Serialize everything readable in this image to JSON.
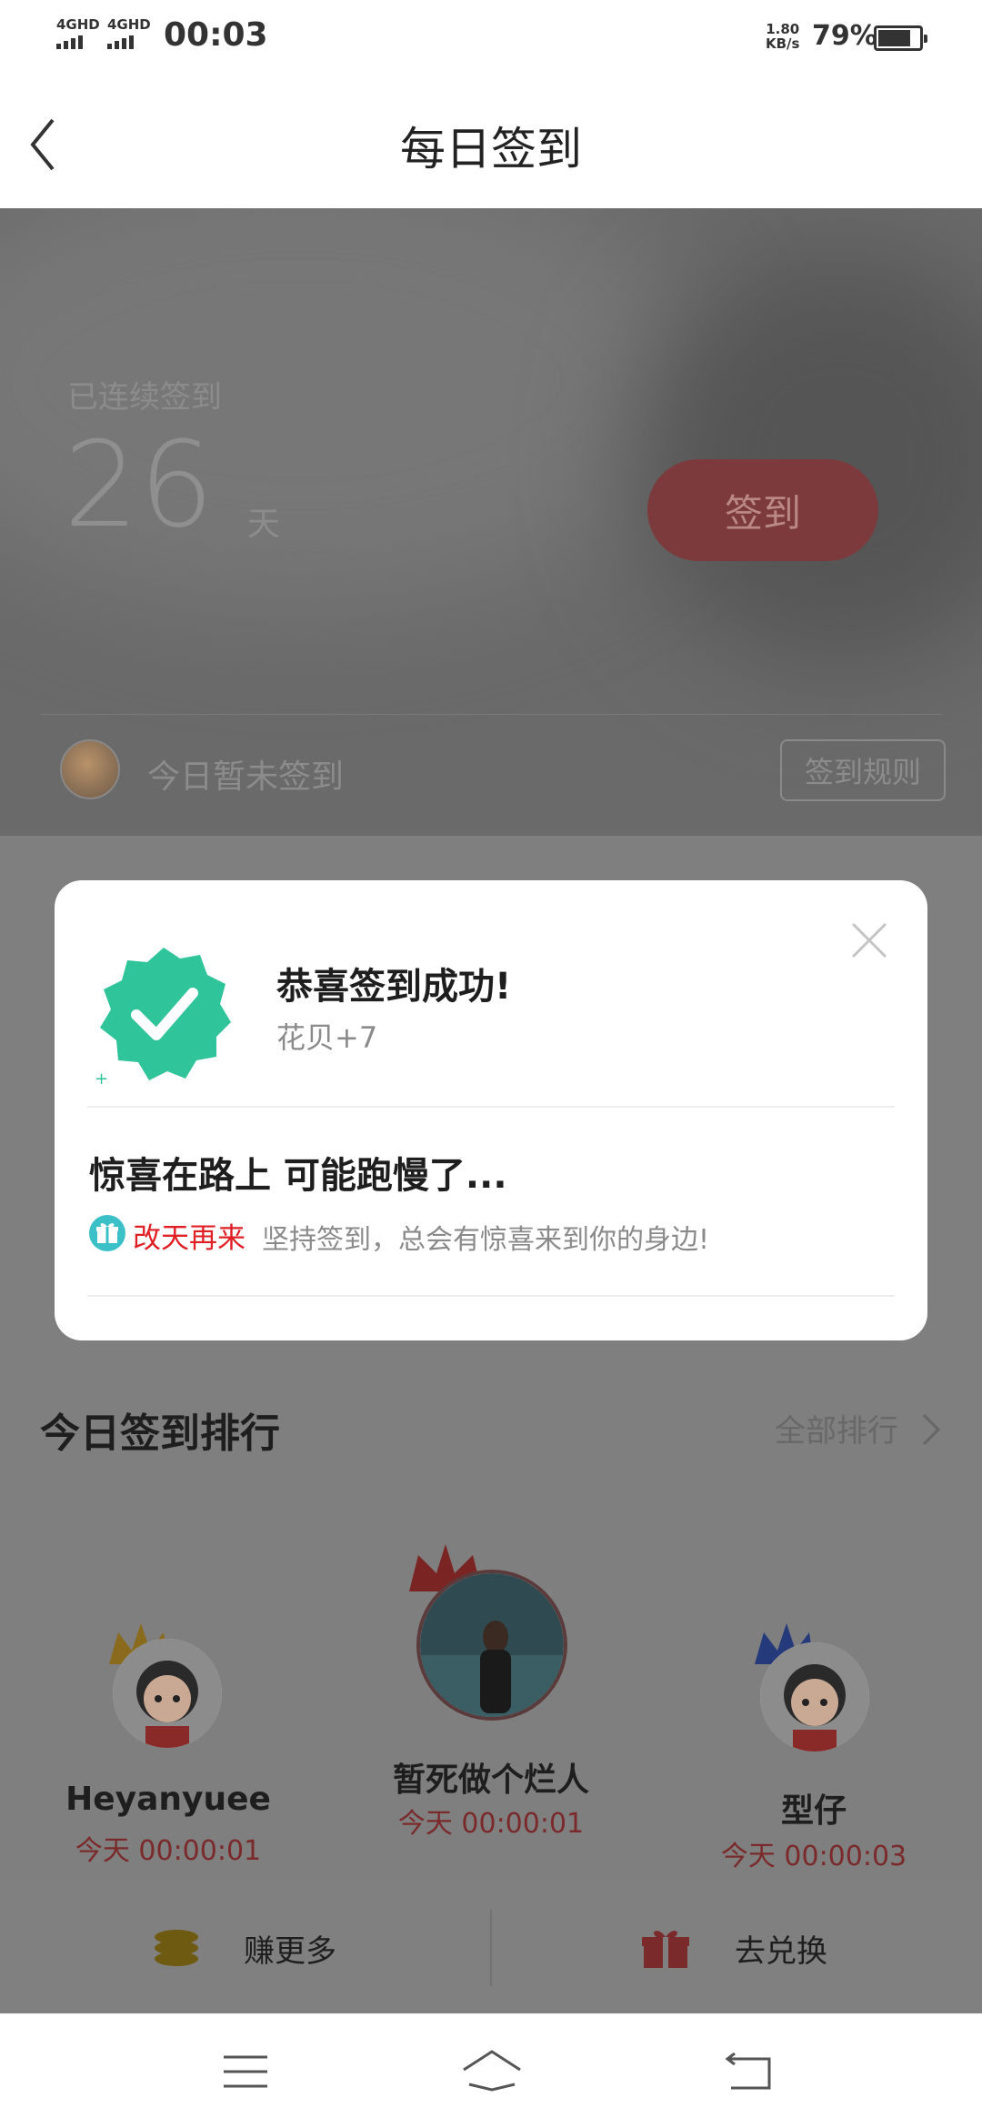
{
  "status_bar": {
    "signal1": "4GHD",
    "signal2": "4GHD",
    "time": "00:03",
    "speed_value": "1.80",
    "speed_unit": "KB/s",
    "battery": "79%",
    "battery_level": 0.79
  },
  "header": {
    "title": "每日签到",
    "back_icon": "chevron-left-icon"
  },
  "hero": {
    "streak_label": "已连续签到",
    "streak_days": "26",
    "streak_unit": "天",
    "checkin_button": "签到",
    "today_status": "今日暂未签到",
    "rules_button": "签到规则"
  },
  "ranking": {
    "title": "今日签到排行",
    "all_link": "全部排行",
    "entries": [
      {
        "name": "Heyanyuee",
        "time": "今天 00:00:01",
        "crown_color": "#d4a22a"
      },
      {
        "name": "暂死做个烂人",
        "time": "今天 00:00:01",
        "crown_color": "#c23a3a"
      },
      {
        "name": "型仔",
        "time": "今天 00:00:03",
        "crown_color": "#3a5cc2"
      }
    ]
  },
  "actions": {
    "earn_more": "赚更多",
    "exchange": "去兑换"
  },
  "modal": {
    "success_title": "恭喜签到成功!",
    "reward": "花贝+7",
    "surprise_title": "惊喜在路上 可能跑慢了...",
    "comeback_label": "改天再来",
    "tip": "坚持签到，总会有惊喜来到你的身边!",
    "accent_color": "#e01f25",
    "badge_color": "#2fc49a"
  },
  "navbar": {
    "icons": [
      "menu-icon",
      "home-icon",
      "back-icon"
    ]
  }
}
